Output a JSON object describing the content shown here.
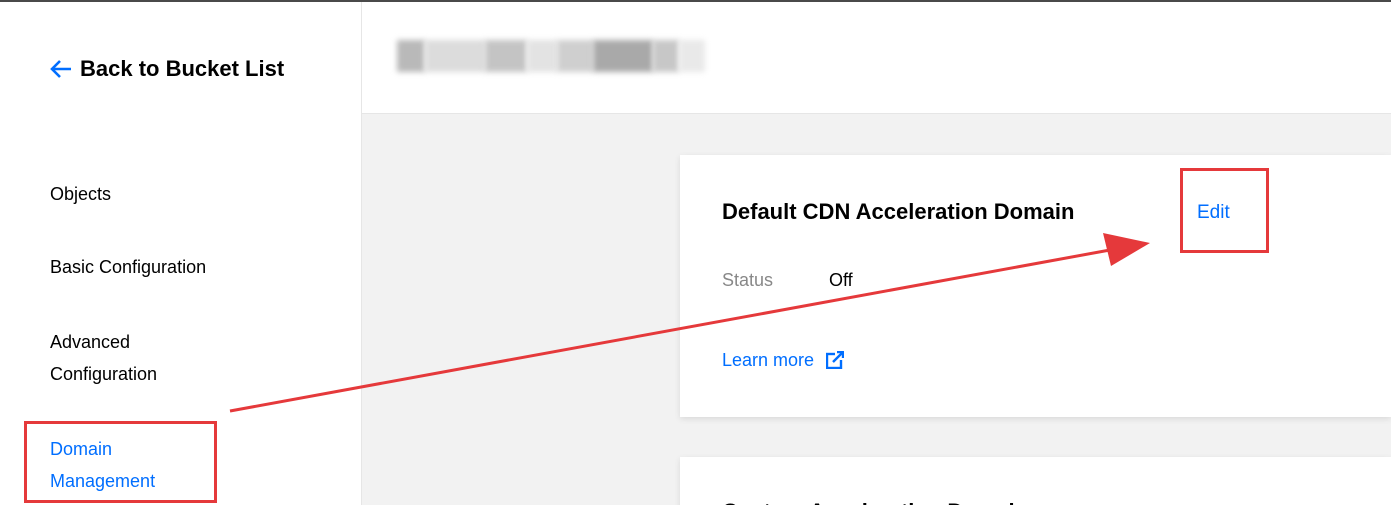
{
  "sidebar": {
    "back_label": "Back to Bucket List",
    "items": [
      {
        "label": "Objects"
      },
      {
        "label": "Basic Configuration"
      },
      {
        "label": "Advanced Configuration"
      },
      {
        "label": "Domain Management",
        "active": true
      }
    ]
  },
  "header": {
    "title": ""
  },
  "card": {
    "title": "Default CDN Acceleration Domain",
    "edit_label": "Edit",
    "status_label": "Status",
    "status_value": "Off",
    "learn_more_label": "Learn more"
  },
  "card2": {
    "title": "Custom Acceleration Domain"
  },
  "colors": {
    "accent": "#006eff",
    "annotation_red": "#e5393b",
    "background": "#f2f2f2"
  },
  "icons": {
    "back": "arrow-left-icon",
    "external": "external-link-icon"
  }
}
